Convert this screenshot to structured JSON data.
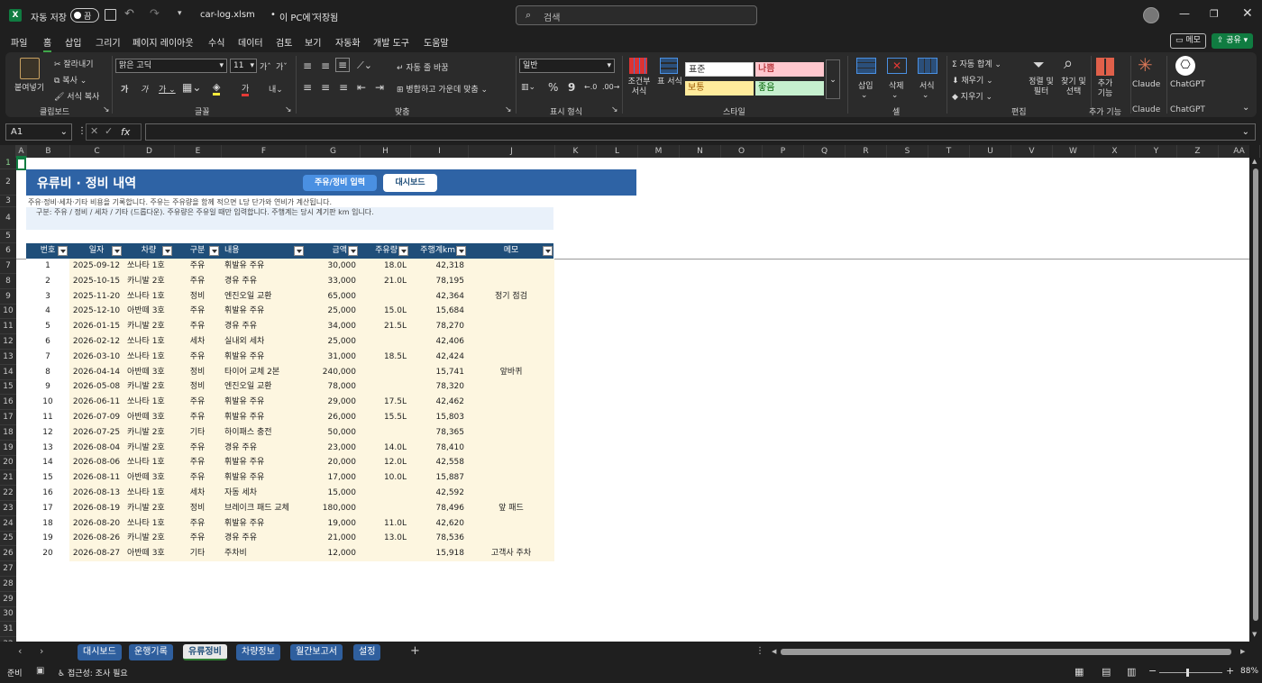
{
  "titlebar": {
    "autosave_label": "자동 저장",
    "autosave_state": "끔",
    "filename": "car-log.xlsm",
    "save_location": "이 PC에 저장됨",
    "search_placeholder": "검색"
  },
  "menu": [
    "파일",
    "홈",
    "삽입",
    "그리기",
    "페이지 레이아웃",
    "수식",
    "데이터",
    "검토",
    "보기",
    "자동화",
    "개발 도구",
    "도움말"
  ],
  "menu_active": "홈",
  "menu_right": {
    "memo": "메모",
    "share": "공유"
  },
  "ribbon": {
    "clipboard": {
      "paste": "붙여넣기",
      "cut": "잘라내기",
      "copy": "복사",
      "format_painter": "서식 복사",
      "group": "클립보드"
    },
    "font": {
      "name": "맑은 고딕",
      "size": "11",
      "group": "글꼴"
    },
    "alignment": {
      "wrap": "자동 줄 바꿈",
      "merge": "병합하고 가운데 맞춤",
      "group": "맞춤"
    },
    "number": {
      "format": "일반",
      "group": "표시 형식"
    },
    "styles": {
      "conditional": "조건부 서식",
      "table": "표 서식",
      "normal": "표준",
      "bad": "나쁨",
      "neutral": "보통",
      "good": "좋음",
      "group": "스타일"
    },
    "cells": {
      "insert": "삽입",
      "delete": "삭제",
      "format": "서식",
      "group": "셀"
    },
    "editing": {
      "autosum": "자동 합계",
      "fill": "채우기",
      "clear": "지우기",
      "sort": "정렬 및 필터",
      "find": "찾기 및 선택",
      "group": "편집"
    },
    "addins": {
      "label": "추가 기능",
      "group": "추가 기능"
    },
    "claude": {
      "label": "Claude",
      "group": "Claude"
    },
    "chatgpt": {
      "label": "ChatGPT",
      "group": "ChatGPT"
    }
  },
  "formula": {
    "namebox": "A1",
    "fx": "fx",
    "content": ""
  },
  "columns": [
    "A",
    "B",
    "C",
    "D",
    "E",
    "F",
    "G",
    "H",
    "I",
    "J",
    "K",
    "L",
    "M",
    "N",
    "O",
    "P",
    "Q",
    "R",
    "S",
    "T",
    "U",
    "V",
    "W",
    "X",
    "Y",
    "Z",
    "AA"
  ],
  "rows": [
    "1",
    "2",
    "3",
    "4",
    "5",
    "6",
    "7",
    "8",
    "9",
    "10",
    "11",
    "12",
    "13",
    "14",
    "15",
    "16",
    "17",
    "18",
    "19",
    "20",
    "21",
    "22",
    "23",
    "24",
    "25",
    "26",
    "27",
    "28",
    "29",
    "30",
    "31",
    "32"
  ],
  "sheet": {
    "title": "유류비 · 정비 내역",
    "btn_input": "주유/정비 입력",
    "btn_dashboard": "대시보드",
    "note1": "주유·정비·세차·기타 비용을 기록합니다. 주유는 주유량을 함께 적으면 L당 단가와 연비가 계산됩니다.",
    "note2": "구분: 주유 / 정비 / 세차 / 기타 (드롭다운). 주유량은 주유일 때만 입력합니다. 주행계는 당시 계기판 km 입니다.",
    "headers": [
      "번호",
      "일자",
      "차량",
      "구분",
      "내용",
      "금액",
      "주유량",
      "주행계km",
      "메모"
    ],
    "records": [
      [
        "1",
        "2025-09-12",
        "쏘나타 1호",
        "주유",
        "휘발유 주유",
        "30,000",
        "18.0L",
        "42,318",
        ""
      ],
      [
        "2",
        "2025-10-15",
        "카니발 2호",
        "주유",
        "경유 주유",
        "33,000",
        "21.0L",
        "78,195",
        ""
      ],
      [
        "3",
        "2025-11-20",
        "쏘나타 1호",
        "정비",
        "엔진오일 교환",
        "65,000",
        "",
        "42,364",
        "정기 점검"
      ],
      [
        "4",
        "2025-12-10",
        "아반떼 3호",
        "주유",
        "휘발유 주유",
        "25,000",
        "15.0L",
        "15,684",
        ""
      ],
      [
        "5",
        "2026-01-15",
        "카니발 2호",
        "주유",
        "경유 주유",
        "34,000",
        "21.5L",
        "78,270",
        ""
      ],
      [
        "6",
        "2026-02-12",
        "쏘나타 1호",
        "세차",
        "실내외 세차",
        "25,000",
        "",
        "42,406",
        ""
      ],
      [
        "7",
        "2026-03-10",
        "쏘나타 1호",
        "주유",
        "휘발유 주유",
        "31,000",
        "18.5L",
        "42,424",
        ""
      ],
      [
        "8",
        "2026-04-14",
        "아반떼 3호",
        "정비",
        "타이어 교체 2본",
        "240,000",
        "",
        "15,741",
        "앞바퀴"
      ],
      [
        "9",
        "2026-05-08",
        "카니발 2호",
        "정비",
        "엔진오일 교환",
        "78,000",
        "",
        "78,320",
        ""
      ],
      [
        "10",
        "2026-06-11",
        "쏘나타 1호",
        "주유",
        "휘발유 주유",
        "29,000",
        "17.5L",
        "42,462",
        ""
      ],
      [
        "11",
        "2026-07-09",
        "아반떼 3호",
        "주유",
        "휘발유 주유",
        "26,000",
        "15.5L",
        "15,803",
        ""
      ],
      [
        "12",
        "2026-07-25",
        "카니발 2호",
        "기타",
        "하이패스 충전",
        "50,000",
        "",
        "78,365",
        ""
      ],
      [
        "13",
        "2026-08-04",
        "카니발 2호",
        "주유",
        "경유 주유",
        "23,000",
        "14.0L",
        "78,410",
        ""
      ],
      [
        "14",
        "2026-08-06",
        "쏘나타 1호",
        "주유",
        "휘발유 주유",
        "20,000",
        "12.0L",
        "42,558",
        ""
      ],
      [
        "15",
        "2026-08-11",
        "아반떼 3호",
        "주유",
        "휘발유 주유",
        "17,000",
        "10.0L",
        "15,887",
        ""
      ],
      [
        "16",
        "2026-08-13",
        "쏘나타 1호",
        "세차",
        "자동 세차",
        "15,000",
        "",
        "42,592",
        ""
      ],
      [
        "17",
        "2026-08-19",
        "카니발 2호",
        "정비",
        "브레이크 패드 교체",
        "180,000",
        "",
        "78,496",
        "앞 패드"
      ],
      [
        "18",
        "2026-08-20",
        "쏘나타 1호",
        "주유",
        "휘발유 주유",
        "19,000",
        "11.0L",
        "42,620",
        ""
      ],
      [
        "19",
        "2026-08-26",
        "카니발 2호",
        "주유",
        "경유 주유",
        "21,000",
        "13.0L",
        "78,536",
        ""
      ],
      [
        "20",
        "2026-08-27",
        "아반떼 3호",
        "기타",
        "주차비",
        "12,000",
        "",
        "15,918",
        "고객사 주차"
      ]
    ]
  },
  "tabs": [
    "대시보드",
    "운행기록",
    "유류정비",
    "차량정보",
    "월간보고서",
    "설정"
  ],
  "active_tab": "유류정비",
  "status": {
    "ready": "준비",
    "accessibility": "접근성: 조사 필요",
    "zoom": "88%"
  },
  "colors": {
    "title_bg": "#2e63a5",
    "header_bg": "#1f4e79",
    "band": "#fdf6e0",
    "note_bg": "#e9f1fa",
    "excel_green": "#107c41"
  }
}
